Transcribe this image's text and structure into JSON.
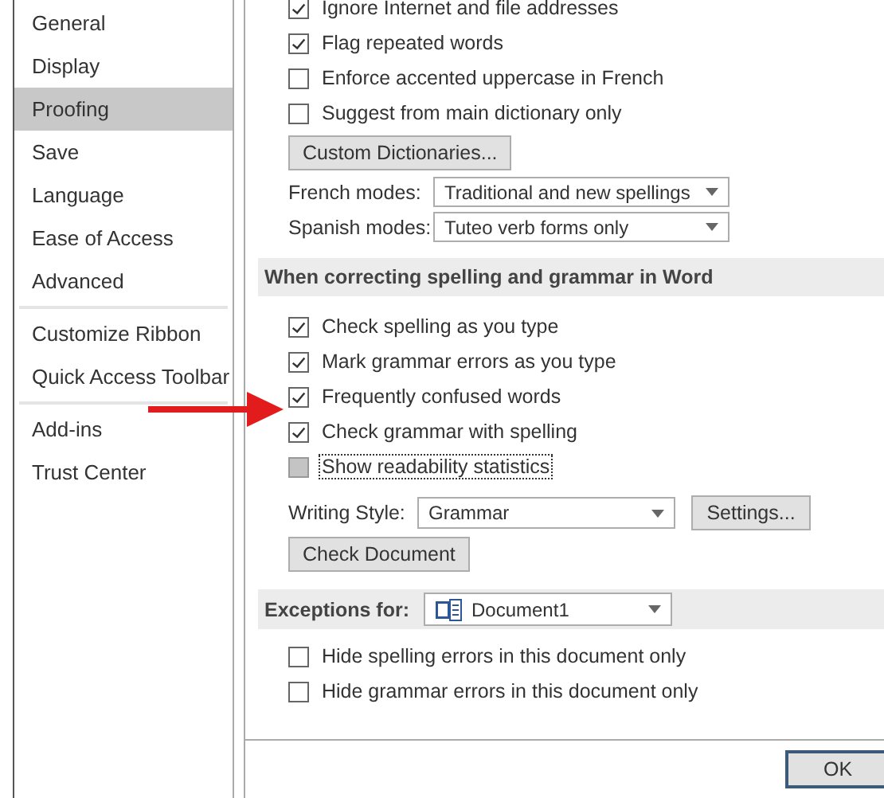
{
  "sidebar": {
    "groups": [
      {
        "items": [
          {
            "label": "General",
            "selected": false
          },
          {
            "label": "Display",
            "selected": false
          },
          {
            "label": "Proofing",
            "selected": true
          },
          {
            "label": "Save",
            "selected": false
          },
          {
            "label": "Language",
            "selected": false
          },
          {
            "label": "Ease of Access",
            "selected": false
          },
          {
            "label": "Advanced",
            "selected": false
          }
        ]
      },
      {
        "items": [
          {
            "label": "Customize Ribbon",
            "selected": false
          },
          {
            "label": "Quick Access Toolbar",
            "selected": false
          }
        ]
      },
      {
        "items": [
          {
            "label": "Add-ins",
            "selected": false
          },
          {
            "label": "Trust Center",
            "selected": false
          }
        ]
      }
    ]
  },
  "office_options": [
    {
      "label": "Ignore Internet and file addresses",
      "checked": true
    },
    {
      "label": "Flag repeated words",
      "checked": true
    },
    {
      "label": "Enforce accented uppercase in French",
      "checked": false
    },
    {
      "label": "Suggest from main dictionary only",
      "checked": false
    }
  ],
  "custom_dictionaries_button": "Custom Dictionaries...",
  "modes": [
    {
      "label": "French modes:",
      "value": "Traditional and new spellings"
    },
    {
      "label": "Spanish modes:",
      "value": "Tuteo verb forms only"
    }
  ],
  "word_section": {
    "title": "When correcting spelling and grammar in Word",
    "options": [
      {
        "label": "Check spelling as you type",
        "checked": true,
        "disabled": false
      },
      {
        "label": "Mark grammar errors as you type",
        "checked": true,
        "disabled": false
      },
      {
        "label": "Frequently confused words",
        "checked": true,
        "disabled": false
      },
      {
        "label": "Check grammar with spelling",
        "checked": true,
        "disabled": false
      },
      {
        "label": "Show readability statistics",
        "checked": false,
        "disabled": true
      }
    ],
    "writing_style": {
      "label": "Writing Style:",
      "value": "Grammar"
    },
    "settings_button": "Settings...",
    "check_document_button": "Check Document"
  },
  "exceptions": {
    "label": "Exceptions for:",
    "document": "Document1",
    "options": [
      {
        "label": "Hide spelling errors in this document only",
        "checked": false
      },
      {
        "label": "Hide grammar errors in this document only",
        "checked": false
      }
    ]
  },
  "footer": {
    "buttons": [
      "OK"
    ]
  }
}
